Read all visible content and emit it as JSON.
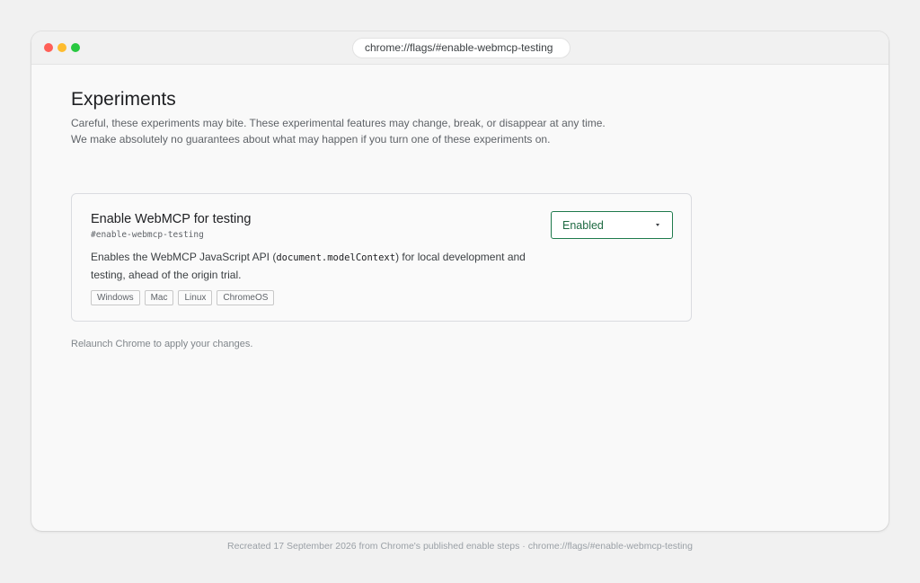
{
  "window": {
    "address_bar": "chrome://flags/#enable-webmcp-testing"
  },
  "page": {
    "title": "Experiments",
    "subtitle": "Careful, these experiments may bite. These experimental features may change, break, or disappear at any time. We make absolutely no guarantees about what may happen if you turn one of these experiments on.",
    "relaunch_text": "Relaunch Chrome to apply your changes."
  },
  "flag": {
    "name": "Enable WebMCP for testing",
    "id": "#enable-webmcp-testing",
    "description_before": "Enables the WebMCP JavaScript API (",
    "description_code": "document.modelContext",
    "description_after": ") for local development and testing, ahead of the origin trial.",
    "platforms": [
      "Windows",
      "Mac",
      "Linux",
      "ChromeOS"
    ],
    "selected_value": "Enabled"
  },
  "footer": {
    "text": "Recreated 17 September 2026 from Chrome's published enable steps · chrome://flags/#enable-webmcp-testing"
  },
  "colors": {
    "accent_green": "#1e7a4c",
    "close_dot": "#ff5f57",
    "minimize_dot": "#febc2e",
    "zoom_dot": "#28c840"
  },
  "icons": {
    "select_caret": "chevron-down-icon"
  }
}
